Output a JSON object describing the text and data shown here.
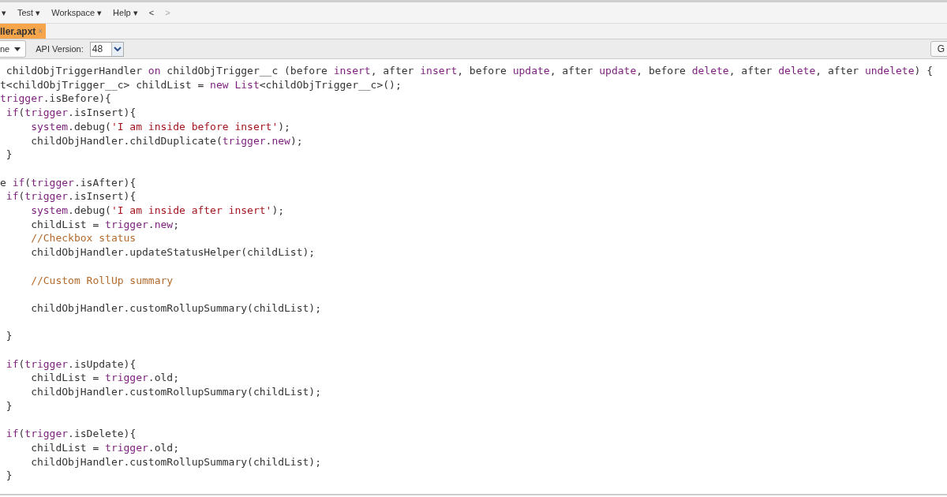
{
  "menu_bar": {
    "items": [
      {
        "label": "▾",
        "disabled": false
      },
      {
        "label": "Test ▾",
        "disabled": false
      },
      {
        "label": "Workspace ▾",
        "disabled": false
      },
      {
        "label": "Help ▾",
        "disabled": false
      },
      {
        "label": "<",
        "disabled": false
      },
      {
        "label": ">",
        "disabled": true
      }
    ]
  },
  "tabs": [
    {
      "label": "ller.apxt",
      "close": "×",
      "selected": true
    }
  ],
  "toolbar": {
    "dropdown": "ne",
    "label": "API Version:",
    "api_version": "48",
    "right_button": "G"
  },
  "editor": {
    "lines": [
      {
        "kind": "code",
        "tokens": [
          {
            "kind": "plain",
            "text": " childObjTriggerHandler "
          },
          {
            "kind": "keyword",
            "text": "on"
          },
          {
            "kind": "plain",
            "text": " childObjTrigger__c (before "
          },
          {
            "kind": "keyword",
            "text": "insert"
          },
          {
            "kind": "plain",
            "text": ", after "
          },
          {
            "kind": "keyword",
            "text": "insert"
          },
          {
            "kind": "plain",
            "text": ", before "
          },
          {
            "kind": "keyword",
            "text": "update"
          },
          {
            "kind": "plain",
            "text": ", after "
          },
          {
            "kind": "keyword",
            "text": "update"
          },
          {
            "kind": "plain",
            "text": ", before "
          },
          {
            "kind": "keyword",
            "text": "delete"
          },
          {
            "kind": "plain",
            "text": ", after "
          },
          {
            "kind": "keyword",
            "text": "delete"
          },
          {
            "kind": "plain",
            "text": ", after "
          },
          {
            "kind": "keyword",
            "text": "undelete"
          },
          {
            "kind": "plain",
            "text": ") {"
          }
        ]
      },
      {
        "kind": "code",
        "tokens": [
          {
            "kind": "plain",
            "text": "t<childObjTrigger__c> childList = "
          },
          {
            "kind": "keyword",
            "text": "new List"
          },
          {
            "kind": "plain",
            "text": "<childObjTrigger__c>();"
          }
        ]
      },
      {
        "kind": "code",
        "tokens": [
          {
            "kind": "keyword",
            "text": "trigger"
          },
          {
            "kind": "plain",
            "text": ".isBefore){"
          }
        ]
      },
      {
        "kind": "code",
        "tokens": [
          {
            "kind": "keyword",
            "text": " if"
          },
          {
            "kind": "plain",
            "text": "("
          },
          {
            "kind": "keyword",
            "text": "trigger"
          },
          {
            "kind": "plain",
            "text": ".isInsert){"
          }
        ]
      },
      {
        "kind": "code",
        "tokens": [
          {
            "kind": "keyword",
            "text": "     system"
          },
          {
            "kind": "plain",
            "text": ".debug("
          },
          {
            "kind": "string",
            "text": "'I am inside before insert'"
          },
          {
            "kind": "plain",
            "text": ");"
          }
        ]
      },
      {
        "kind": "code",
        "tokens": [
          {
            "kind": "plain",
            "text": "     childObjHandler.childDuplicate("
          },
          {
            "kind": "keyword",
            "text": "trigger"
          },
          {
            "kind": "plain",
            "text": "."
          },
          {
            "kind": "keyword",
            "text": "new"
          },
          {
            "kind": "plain",
            "text": ");"
          }
        ]
      },
      {
        "kind": "code",
        "tokens": [
          {
            "kind": "plain",
            "text": " }"
          }
        ]
      },
      {
        "kind": "blank"
      },
      {
        "kind": "code",
        "tokens": [
          {
            "kind": "plain",
            "text": "e "
          },
          {
            "kind": "keyword",
            "text": "if"
          },
          {
            "kind": "plain",
            "text": "("
          },
          {
            "kind": "keyword",
            "text": "trigger"
          },
          {
            "kind": "plain",
            "text": ".isAfter){"
          }
        ]
      },
      {
        "kind": "code",
        "tokens": [
          {
            "kind": "keyword",
            "text": " if"
          },
          {
            "kind": "plain",
            "text": "("
          },
          {
            "kind": "keyword",
            "text": "trigger"
          },
          {
            "kind": "plain",
            "text": ".isInsert){"
          }
        ]
      },
      {
        "kind": "code",
        "tokens": [
          {
            "kind": "keyword",
            "text": "     system"
          },
          {
            "kind": "plain",
            "text": ".debug("
          },
          {
            "kind": "string",
            "text": "'I am inside after insert'"
          },
          {
            "kind": "plain",
            "text": ");"
          }
        ]
      },
      {
        "kind": "code",
        "tokens": [
          {
            "kind": "plain",
            "text": "     childList = "
          },
          {
            "kind": "keyword",
            "text": "trigger"
          },
          {
            "kind": "plain",
            "text": "."
          },
          {
            "kind": "keyword",
            "text": "new"
          },
          {
            "kind": "plain",
            "text": ";"
          }
        ]
      },
      {
        "kind": "code",
        "tokens": [
          {
            "kind": "comment",
            "text": "     //Checkbox status"
          }
        ]
      },
      {
        "kind": "code",
        "tokens": [
          {
            "kind": "plain",
            "text": "     childObjHandler.updateStatusHelper(childList);"
          }
        ]
      },
      {
        "kind": "blank"
      },
      {
        "kind": "code",
        "tokens": [
          {
            "kind": "comment",
            "text": "     //Custom RollUp summary"
          }
        ]
      },
      {
        "kind": "blank"
      },
      {
        "kind": "code",
        "tokens": [
          {
            "kind": "plain",
            "text": "     childObjHandler.customRollupSummary(childList);"
          }
        ]
      },
      {
        "kind": "blank"
      },
      {
        "kind": "code",
        "tokens": [
          {
            "kind": "plain",
            "text": " }"
          }
        ]
      },
      {
        "kind": "blank"
      },
      {
        "kind": "code",
        "tokens": [
          {
            "kind": "keyword",
            "text": " if"
          },
          {
            "kind": "plain",
            "text": "("
          },
          {
            "kind": "keyword",
            "text": "trigger"
          },
          {
            "kind": "plain",
            "text": ".isUpdate){"
          }
        ]
      },
      {
        "kind": "code",
        "tokens": [
          {
            "kind": "plain",
            "text": "     childList = "
          },
          {
            "kind": "keyword",
            "text": "trigger"
          },
          {
            "kind": "plain",
            "text": ".old;"
          }
        ]
      },
      {
        "kind": "code",
        "tokens": [
          {
            "kind": "plain",
            "text": "     childObjHandler.customRollupSummary(childList);"
          }
        ]
      },
      {
        "kind": "code",
        "tokens": [
          {
            "kind": "plain",
            "text": " }"
          }
        ]
      },
      {
        "kind": "blank"
      },
      {
        "kind": "code",
        "tokens": [
          {
            "kind": "keyword",
            "text": " if"
          },
          {
            "kind": "plain",
            "text": "("
          },
          {
            "kind": "keyword",
            "text": "trigger"
          },
          {
            "kind": "plain",
            "text": ".isDelete){"
          }
        ]
      },
      {
        "kind": "code",
        "tokens": [
          {
            "kind": "plain",
            "text": "     childList = "
          },
          {
            "kind": "keyword",
            "text": "trigger"
          },
          {
            "kind": "plain",
            "text": ".old;"
          }
        ]
      },
      {
        "kind": "code",
        "tokens": [
          {
            "kind": "plain",
            "text": "     childObjHandler.customRollupSummary(childList);"
          }
        ]
      },
      {
        "kind": "code",
        "tokens": [
          {
            "kind": "plain",
            "text": " }"
          }
        ]
      }
    ]
  }
}
